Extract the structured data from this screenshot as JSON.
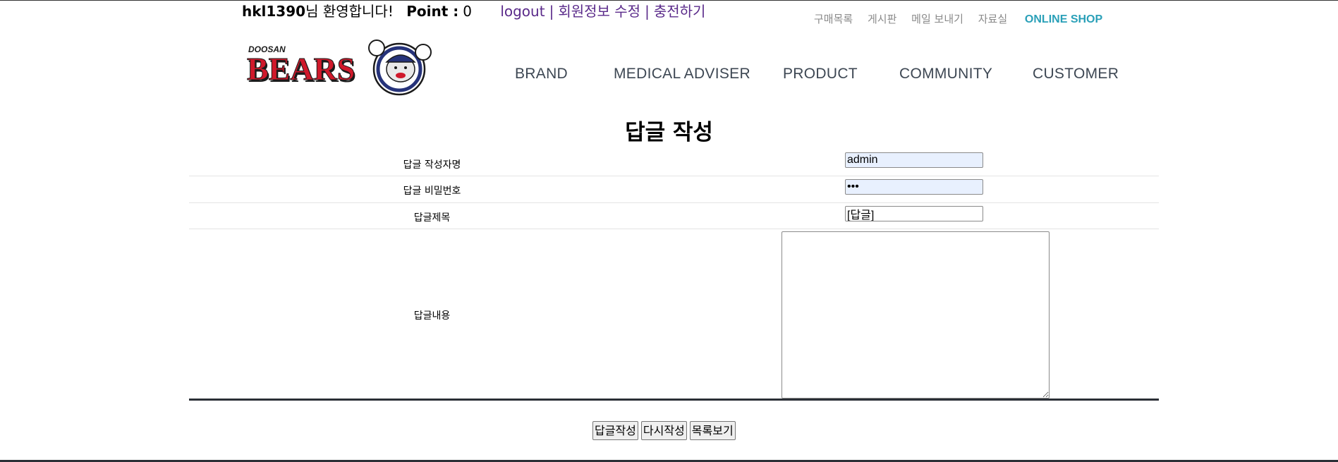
{
  "userbar": {
    "user_id": "hkl1390",
    "welcome": "님 환영합니다!",
    "point_label": "Point :",
    "point_value": "0",
    "logout": "logout",
    "sep": "|",
    "edit_profile": "회원정보 수정",
    "charge": "충전하기"
  },
  "utility_nav": [
    "구매목록",
    "게시판",
    "메일 보내기",
    "자료실"
  ],
  "online_shop": "ONLINE SHOP",
  "logo": {
    "brand_small": "DOOSAN",
    "brand_big": "BEARS"
  },
  "main_nav": [
    "BRAND",
    "MEDICAL ADVISER",
    "PRODUCT",
    "COMMUNITY",
    "CUSTOMER"
  ],
  "page_title": "답글 작성",
  "form": {
    "writer_label": "답글 작성자명",
    "writer_value": "admin",
    "password_label": "답글 비밀번호",
    "password_value": "•••",
    "subject_label": "답글제목",
    "subject_value": "[답글]",
    "content_label": "답글내용",
    "content_value": ""
  },
  "buttons": {
    "submit": "답글작성",
    "reset": "다시작성",
    "list": "목록보기"
  },
  "colors": {
    "accent_shop": "#2aa0b8",
    "link_purple": "#5a2a8a",
    "nav_text": "#3d4753",
    "logo_red": "#d0192b"
  }
}
